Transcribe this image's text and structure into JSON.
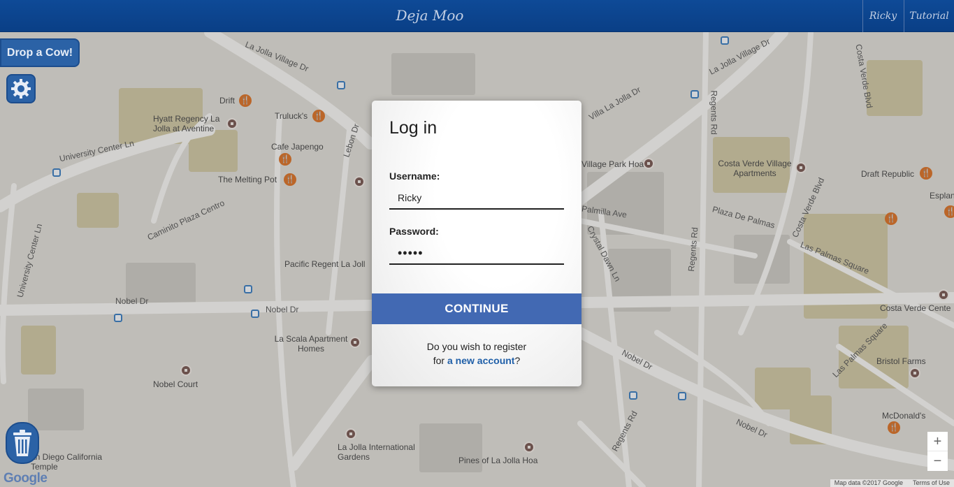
{
  "header": {
    "brand": "Deja Moo",
    "nav": {
      "user": "Ricky",
      "tutorial": "Tutorial"
    }
  },
  "controls": {
    "drop_cow": "Drop a Cow!",
    "settings_icon": "gear-icon",
    "trash_icon": "trash-icon",
    "zoom_in": "+",
    "zoom_out": "−"
  },
  "map": {
    "places": [
      "Drift",
      "Hyatt Regency La Jolla at Aventine",
      "Truluck's",
      "Cafe Japengo",
      "The Melting Pot",
      "Village Park Hoa",
      "Costa Verde Village Apartments",
      "Draft Republic",
      "Esplanade",
      "Pacific Regent La Joll",
      "La Scala Apartment Homes",
      "Nobel Court",
      "Costa Verde Cente",
      "Bristol Farms",
      "McDonald's",
      "La Jolla International Gardens",
      "Pines of La Jolla Hoa",
      "an Diego California Temple"
    ],
    "roads": [
      "La Jolla Village Dr",
      "University Center Ln",
      "Caminito Plaza Centro",
      "Lebon Dr",
      "Nobel Dr",
      "Regents Rd",
      "Costa Verde Blvd",
      "Plaza De Palmas",
      "Las Palmas Square",
      "Crystal Dawn Ln",
      "Villa La Jolla Dr",
      "Palmilla Ave"
    ],
    "google_logo": "Google",
    "attribution": {
      "data": "Map data ©2017 Google",
      "terms": "Terms of Use"
    }
  },
  "login": {
    "title": "Log in",
    "username_label": "Username:",
    "username_value": "Ricky",
    "password_label": "Password:",
    "password_value": "•••••",
    "continue_label": "CONTINUE",
    "register_prefix": "Do you wish to register",
    "register_for": "for",
    "register_link": "a new account",
    "register_suffix": "?"
  },
  "colors": {
    "header": "#0e4a97",
    "button": "#4269b3",
    "link": "#1f5fa8",
    "control": "#2b62a6"
  }
}
